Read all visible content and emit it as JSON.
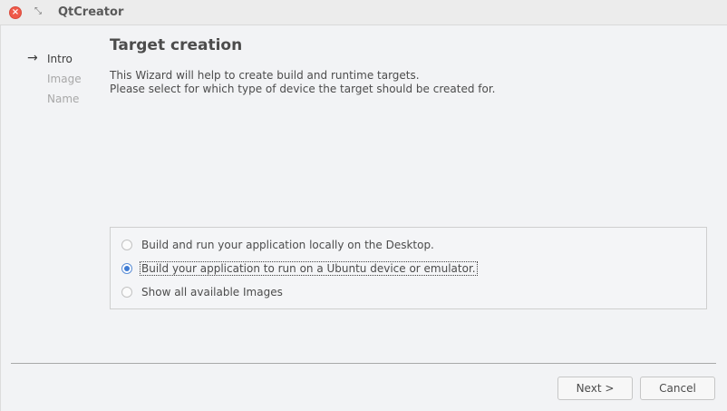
{
  "window": {
    "title": "QtCreator",
    "close_icon": "close-icon",
    "restore_icon": "restore-icon"
  },
  "wizard": {
    "steps": [
      {
        "label": "Intro",
        "active": true
      },
      {
        "label": "Image",
        "active": false
      },
      {
        "label": "Name",
        "active": false
      }
    ],
    "current_step_icon": "arrow-right-icon",
    "page_title": "Target creation",
    "description": [
      "This Wizard will help to create build and runtime targets.",
      "Please select for which type of device the target should be created for."
    ],
    "options": [
      {
        "label": "Build and run your application locally on the Desktop.",
        "checked": false
      },
      {
        "label": "Build  your application to run on a Ubuntu device or emulator.",
        "checked": true
      },
      {
        "label": "Show all available Images",
        "checked": false
      }
    ]
  },
  "buttons": {
    "next_label": "Next >",
    "cancel_label": "Cancel"
  },
  "colors": {
    "accent": "#3e7bd3",
    "close": "#ef5a4a"
  }
}
